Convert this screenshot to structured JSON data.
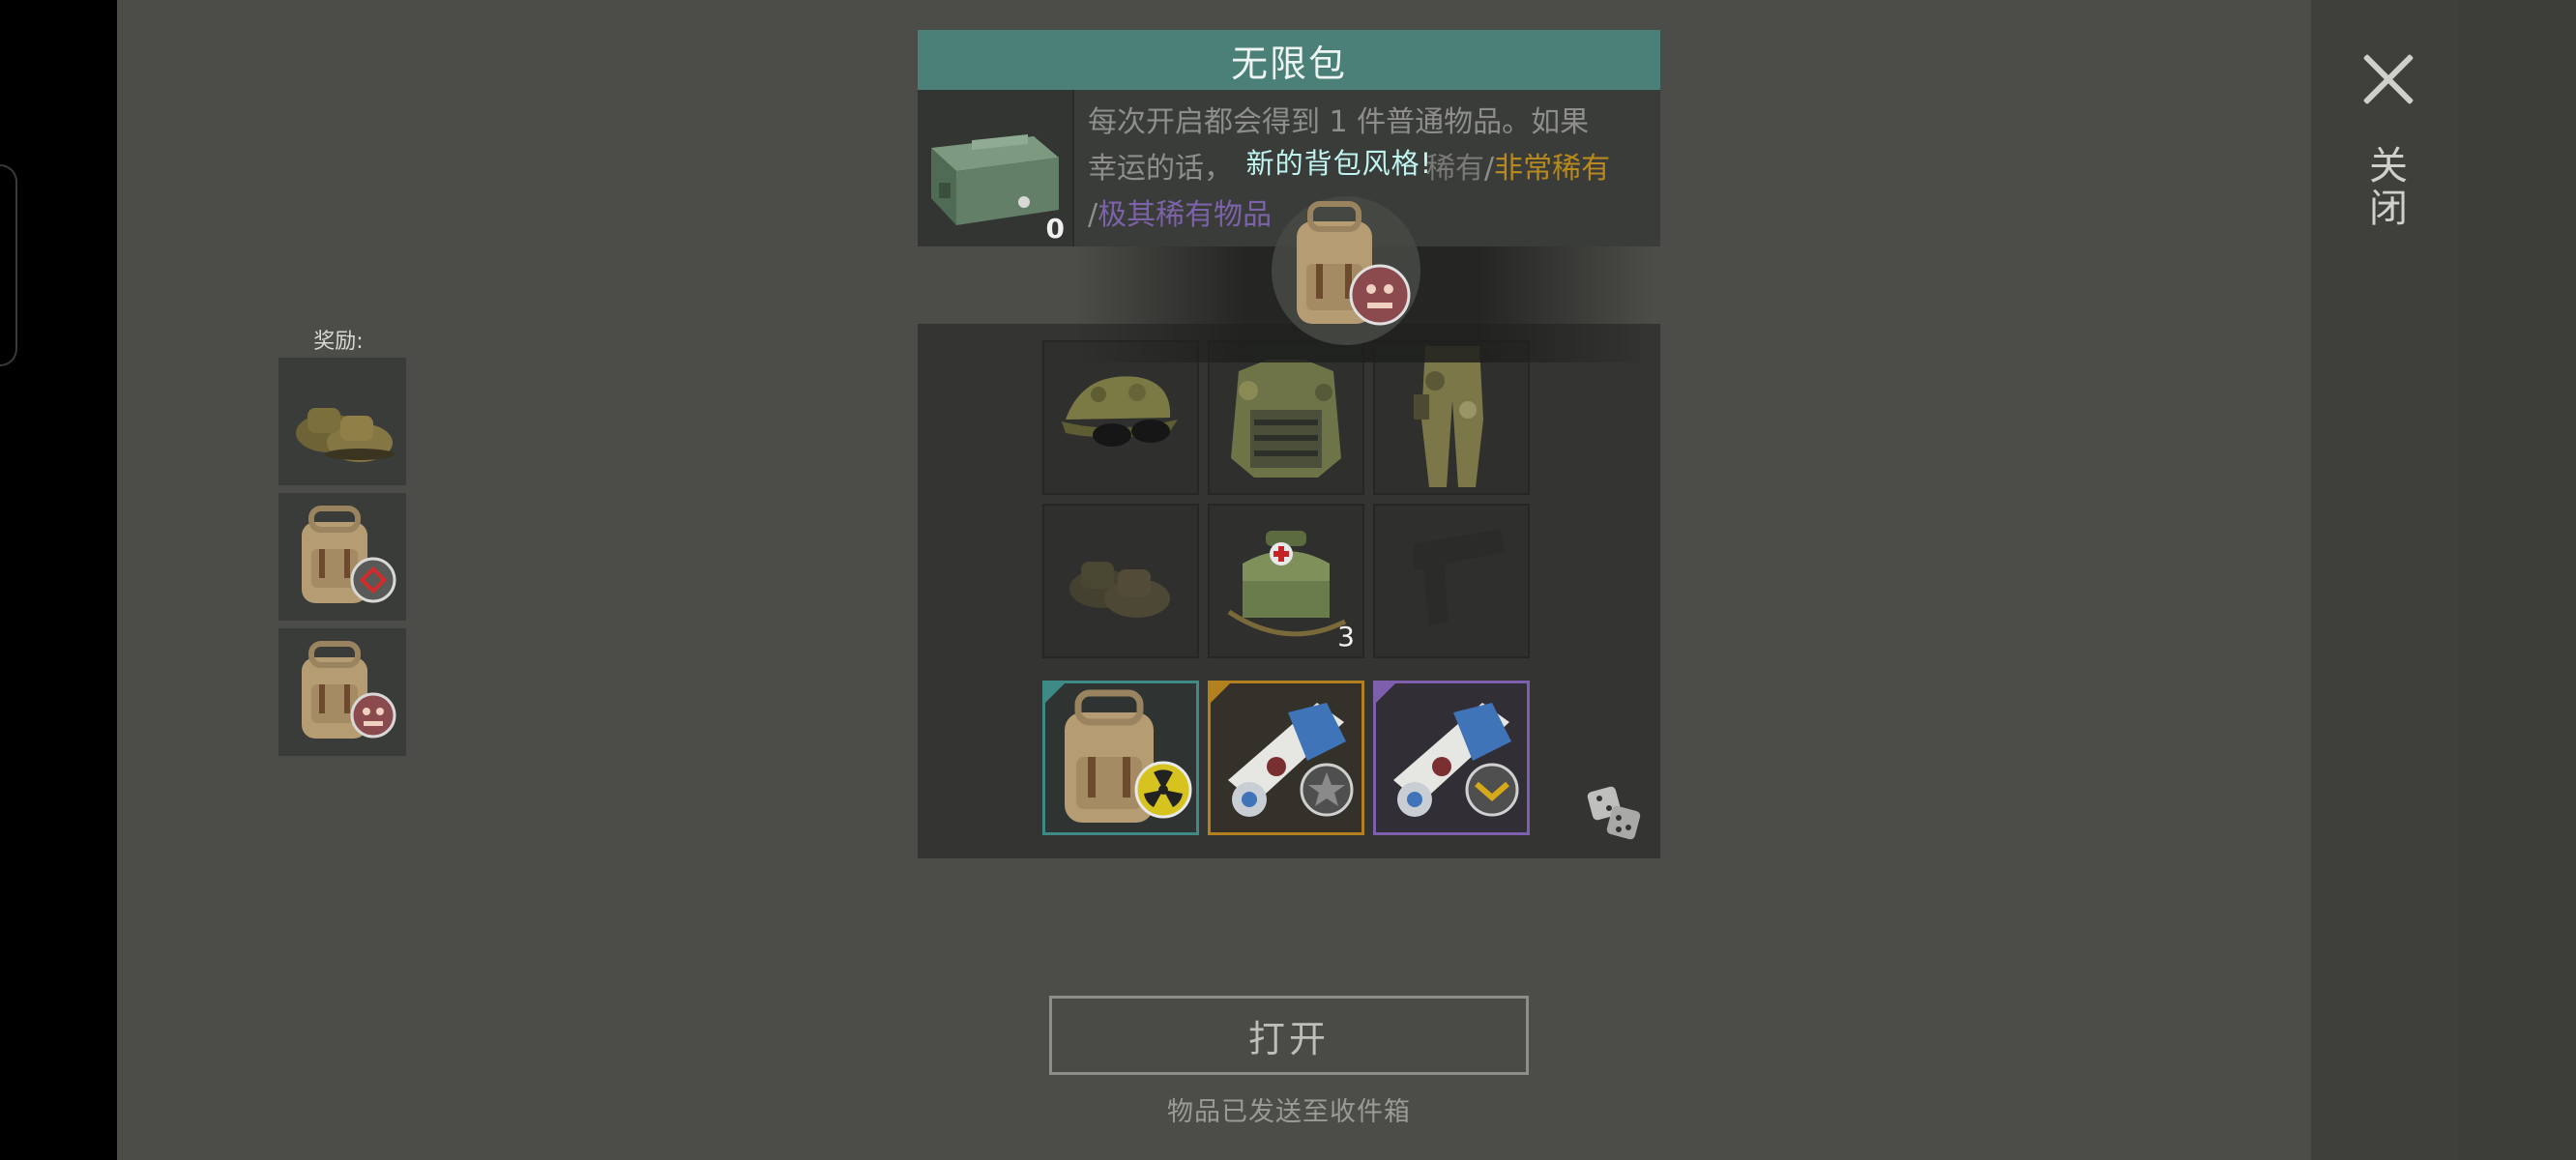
{
  "dialog": {
    "title": "无限包",
    "crate_count": "0",
    "description": {
      "line1": "每次开启都会得到 1 件普通物品。如果",
      "line2_prefix": "幸运的话，",
      "rare": "稀有",
      "slash1": "/",
      "very_rare": "非常稀有",
      "line3_slash": "/",
      "epic": "极其稀有物品"
    },
    "popup_text": "新的背包风格!"
  },
  "rewards": {
    "title": "奖励:",
    "items": [
      {
        "icon": "boots-icon"
      },
      {
        "icon": "backpack-red-badge-icon"
      },
      {
        "icon": "backpack-monster-badge-icon"
      }
    ]
  },
  "grid": {
    "rows": [
      [
        {
          "icon": "cap-sunglasses-icon"
        },
        {
          "icon": "camo-vest-icon"
        },
        {
          "icon": "camo-pants-icon"
        }
      ],
      [
        {
          "icon": "boots-faded-icon"
        },
        {
          "icon": "medkit-bag-icon",
          "count": "3"
        },
        {
          "icon": "pistol-faded-icon"
        }
      ],
      [
        {
          "icon": "backpack-radiation-icon",
          "rarity": "teal"
        },
        {
          "icon": "scroll-star-icon",
          "rarity": "orange"
        },
        {
          "icon": "scroll-chevron-icon",
          "rarity": "purple"
        }
      ]
    ]
  },
  "actions": {
    "open_label": "打开",
    "sent_note": "物品已发送至收件箱",
    "close_label": "关闭"
  },
  "colors": {
    "title_bar": "#4a8078",
    "teal_rarity": "#3e8a86",
    "orange_rarity": "#b3801f",
    "purple_rarity": "#7d5fae",
    "popup_text": "#bff4f0"
  }
}
